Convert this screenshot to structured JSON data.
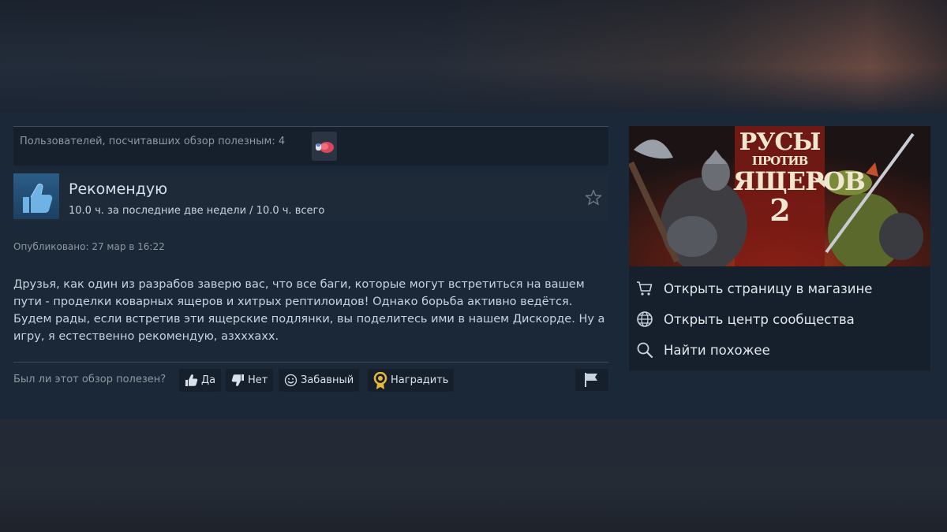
{
  "helpful": {
    "text": "Пользователей, посчитавших обзор полезным: 4"
  },
  "review": {
    "verdict": "Рекомендую",
    "hours": "10.0 ч. за последние две недели / 10.0 ч. всего",
    "posted": "Опубликовано: 27 мар в 16:22",
    "body": "Друзья, как один из разрабов заверю вас, что все баги, которые могут встретиться на вашем пути - проделки коварных ящеров и хитрых рептилоидов! Однако борьба активно ведётся. Будем рады, если встретив эти ящерские подлянки, вы поделитесь ими в нашем Дискорде. Ну а игру, я естественно рекомендую, азхххахх."
  },
  "vote": {
    "question": "Был ли этот обзор полезен?",
    "yes": "Да",
    "no": "Нет",
    "funny": "Забавный",
    "award": "Наградить"
  },
  "game": {
    "capsule_lines": [
      "РУСЫ",
      "ПРОТИВ",
      "ЯЩЕРОВ",
      "2"
    ],
    "links": [
      {
        "icon": "cart-icon",
        "label": "Открыть страницу в магазине"
      },
      {
        "icon": "globe-icon",
        "label": "Открыть центр сообщества"
      },
      {
        "icon": "search-icon",
        "label": "Найти похожее"
      }
    ]
  },
  "colors": {
    "background": "#1b2838",
    "panel": "#16202d",
    "thumb": "#2b5c86",
    "award_gold": "#e8b73a"
  }
}
